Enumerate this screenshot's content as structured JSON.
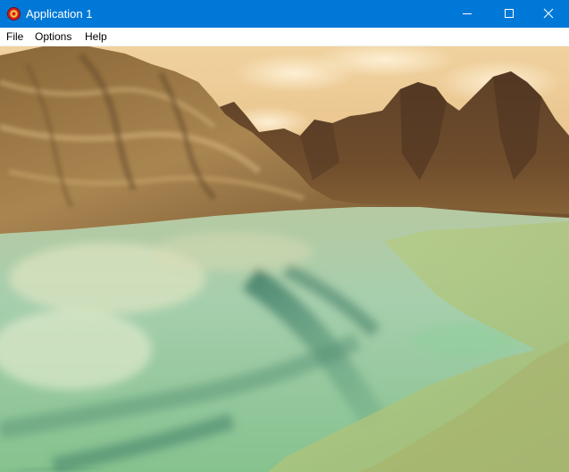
{
  "window": {
    "title": "Application 1",
    "titlebar_color": "#0078d7",
    "icon": "app-icon"
  },
  "caption_buttons": {
    "minimize_icon": "minimize-icon",
    "maximize_icon": "maximize-icon",
    "close_icon": "close-icon"
  },
  "menu": {
    "items": [
      {
        "label": "File"
      },
      {
        "label": "Options"
      },
      {
        "label": "Help"
      }
    ]
  },
  "scene": {
    "description_kind": "3d-rendered-terrain",
    "colors": {
      "sky": "#e8c89a",
      "mountains": "#7a5a32",
      "mountains_dark": "#4a3220",
      "water": "#9fcfa5",
      "water_deep": "#4d8a72",
      "shore": "#a9c77e"
    }
  }
}
